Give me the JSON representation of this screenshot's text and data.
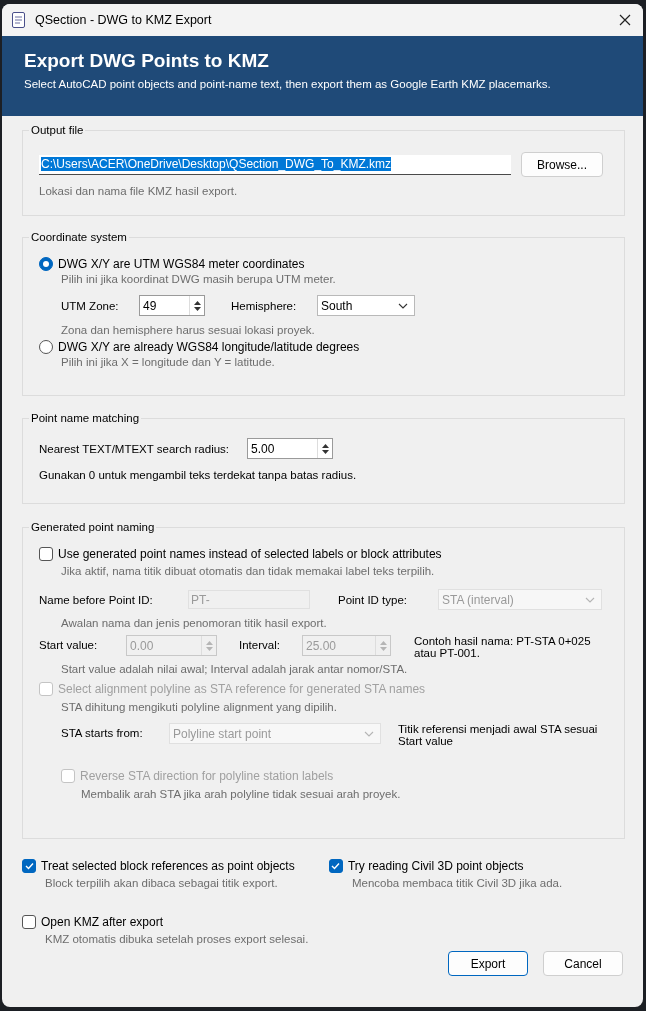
{
  "window": {
    "title": "QSection - DWG to KMZ Export"
  },
  "header": {
    "title": "Export DWG Points to KMZ",
    "subtitle": "Select AutoCAD point objects and point-name text, then export them as Google Earth KMZ placemarks."
  },
  "output_file": {
    "legend": "Output file",
    "path": "C:\\Users\\ACER\\OneDrive\\Desktop\\QSection_DWG_To_KMZ.kmz",
    "browse": "Browse...",
    "hint": "Lokasi dan nama file KMZ hasil export."
  },
  "coordinate_system": {
    "legend": "Coordinate system",
    "options": [
      {
        "label": "DWG X/Y are UTM WGS84 meter coordinates",
        "hint": "Pilih ini jika koordinat DWG masih berupa UTM meter.",
        "selected": true
      },
      {
        "label": "DWG X/Y are already WGS84 longitude/latitude degrees",
        "hint": "Pilih ini jika X = longitude dan Y = latitude.",
        "selected": false
      }
    ],
    "utm_zone_label": "UTM Zone:",
    "utm_zone": "49",
    "hemisphere_label": "Hemisphere:",
    "hemisphere": "South",
    "zone_hint": "Zona dan hemisphere harus sesuai lokasi proyek."
  },
  "point_name_matching": {
    "legend": "Point name matching",
    "radius_label": "Nearest TEXT/MTEXT search radius:",
    "radius": "5.00",
    "hint": "Gunakan 0 untuk mengambil teks terdekat tanpa batas radius."
  },
  "generated_naming": {
    "legend": "Generated point naming",
    "use_generated": {
      "label": "Use generated point names instead of selected labels or block attributes",
      "checked": false,
      "disabled": false,
      "hint": "Jika aktif, nama titik dibuat otomatis dan tidak memakai label teks terpilih."
    },
    "name_before_label": "Name before Point ID:",
    "name_before": {
      "value": "PT-",
      "disabled": true
    },
    "point_id_type_label": "Point ID type:",
    "point_id_type": {
      "value": "STA (interval)",
      "disabled": true
    },
    "prefix_hint": "Awalan nama dan jenis penomoran titik hasil export.",
    "start_value_label": "Start value:",
    "start_value": {
      "value": "0.00",
      "disabled": true
    },
    "interval_label": "Interval:",
    "interval": {
      "value": "25.00",
      "disabled": true
    },
    "example": "Contoh hasil nama: PT-STA 0+025 atau PT-001.",
    "values_hint": "Start value adalah nilai awal; Interval adalah jarak antar nomor/STA.",
    "select_alignment": {
      "label": "Select alignment polyline as STA reference for generated STA names",
      "checked": false,
      "disabled": true,
      "hint": "STA dihitung mengikuti polyline alignment yang dipilih."
    },
    "sta_starts_label": "STA starts from:",
    "sta_starts": {
      "value": "Polyline start point",
      "disabled": true
    },
    "sta_note": "Titik referensi menjadi awal STA sesuai Start value",
    "reverse": {
      "label": "Reverse STA direction for polyline station labels",
      "checked": false,
      "disabled": true,
      "hint": "Membalik arah STA jika arah polyline tidak sesuai arah proyek."
    }
  },
  "options": [
    {
      "label": "Treat selected block references as point objects",
      "checked": true,
      "hint": "Block terpilih akan dibaca sebagai titik export."
    },
    {
      "label": "Try reading Civil 3D point objects",
      "checked": true,
      "hint": "Mencoba membaca titik Civil 3D jika ada."
    }
  ],
  "open_kmz": {
    "label": "Open KMZ after export",
    "checked": false,
    "hint": "KMZ otomatis dibuka setelah proses export selesai."
  },
  "buttons": [
    {
      "label": "Export",
      "default": true
    },
    {
      "label": "Cancel",
      "default": false
    }
  ]
}
